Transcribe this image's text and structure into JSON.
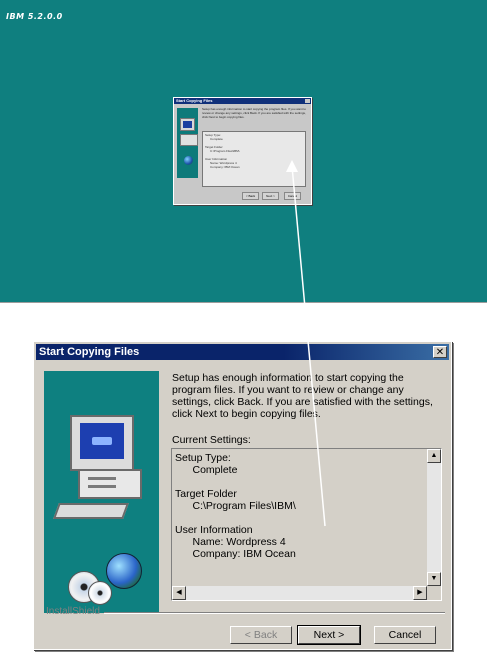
{
  "desktop": {
    "title": "IBM 5.2.0.0",
    "bg_color": "#0f7f7f"
  },
  "mini_window": {
    "title": "Start Copying Files",
    "back_label": "< Back",
    "next_label": "Next >",
    "cancel_label": "Cancel"
  },
  "window": {
    "title": "Start Copying Files",
    "close_label": "✕",
    "description": "Setup has enough information to start copying the program files. If you want to review or change any settings, click Back. If you are satisfied with the settings, click Next to begin copying files.",
    "settings_label": "Current Settings:",
    "settings_text": "Setup Type:\n      Complete\n\nTarget Folder\n      C:\\Program Files\\IBM\\\n\nUser Information\n      Name: Wordpress 4\n      Company: IBM Ocean",
    "installshield_label": "InstallShield",
    "buttons": {
      "back": "< Back",
      "next": "Next >",
      "cancel": "Cancel"
    },
    "title_color": "#0a246a"
  }
}
